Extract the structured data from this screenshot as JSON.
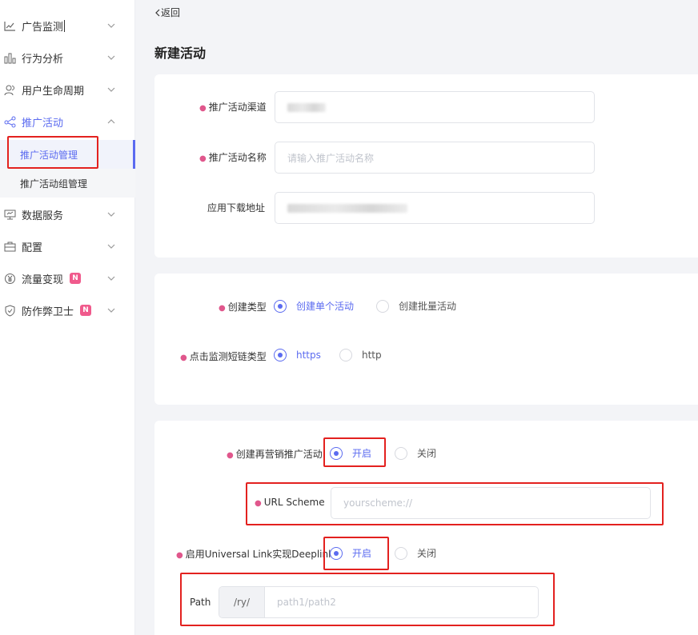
{
  "sidebar": {
    "items": [
      {
        "label": "广告监测",
        "icon": "line-chart-icon"
      },
      {
        "label": "行为分析",
        "icon": "bar-chart-icon"
      },
      {
        "label": "用户生命周期",
        "icon": "users-icon"
      },
      {
        "label": "推广活动",
        "icon": "share-icon"
      },
      {
        "label": "数据服务",
        "icon": "monitor-icon"
      },
      {
        "label": "配置",
        "icon": "briefcase-icon"
      },
      {
        "label": "流量变现",
        "icon": "yuan-icon",
        "badge": "N"
      },
      {
        "label": "防作弊卫士",
        "icon": "shield-icon",
        "badge": "N"
      }
    ],
    "sub_items": [
      {
        "label": "推广活动管理"
      },
      {
        "label": "推广活动组管理"
      }
    ]
  },
  "header": {
    "back_label": "返回",
    "title": "新建活动"
  },
  "form1": {
    "channel_label": "推广活动渠道",
    "name_label": "推广活动名称",
    "name_placeholder": "请输入推广活动名称",
    "download_label": "应用下载地址"
  },
  "form2": {
    "create_type_label": "创建类型",
    "create_single": "创建单个活动",
    "create_batch": "创建批量活动",
    "link_type_label": "点击监测短链类型",
    "https": "https",
    "http": "http"
  },
  "form3": {
    "remarketing_label": "创建再营销推广活动",
    "on": "开启",
    "off": "关闭",
    "url_scheme_label": "URL Scheme",
    "url_scheme_placeholder": "yourscheme://",
    "universal_link_label": "启用Universal Link实现Deeplink",
    "path_label": "Path",
    "path_prefix": "/ry/",
    "path_placeholder": "path1/path2"
  },
  "colors": {
    "accent": "#5b6bf0",
    "required": "#e0578c",
    "highlight": "#e3211f",
    "badge": "#f05a8c"
  }
}
